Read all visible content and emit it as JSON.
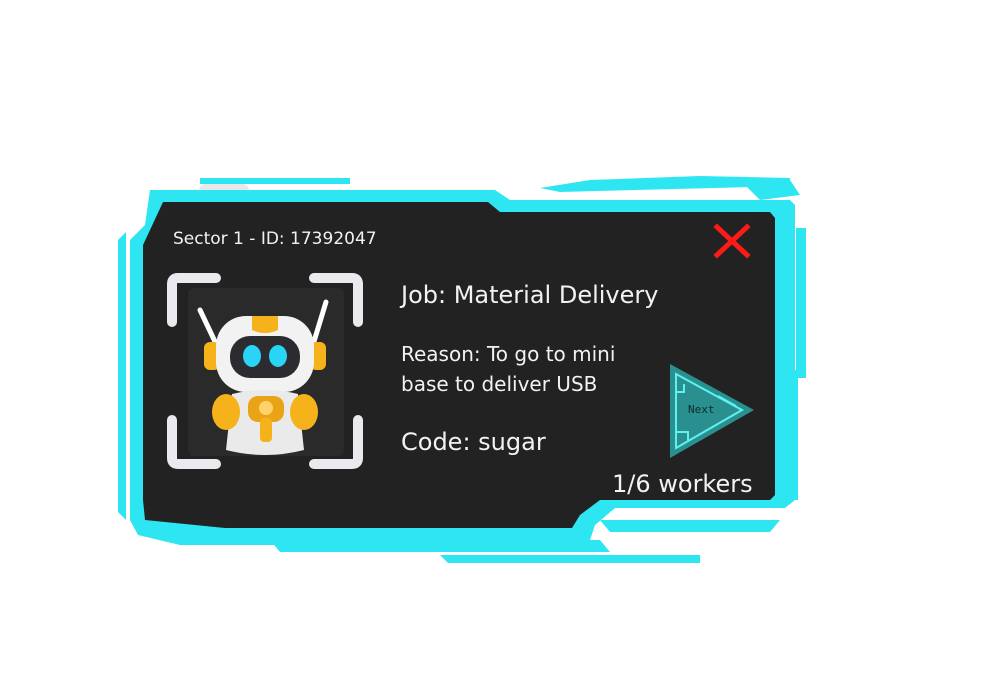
{
  "panel": {
    "sector_id": "Sector 1 - ID: 17392047",
    "job": "Job: Material Delivery",
    "reason": "Reason: To go to mini base to deliver USB",
    "code": "Code: sugar",
    "workers": "1/6 workers"
  },
  "buttons": {
    "next_label": "Next",
    "close_icon": "close-x-icon"
  },
  "colors": {
    "frame_cyan": "#2ee6f2",
    "panel_bg": "#232222",
    "close_red": "#ff1a1a",
    "next_teal": "#2a8f8f"
  },
  "icons": {
    "avatar": "robot-avatar-icon",
    "next": "play-arrow-icon"
  }
}
